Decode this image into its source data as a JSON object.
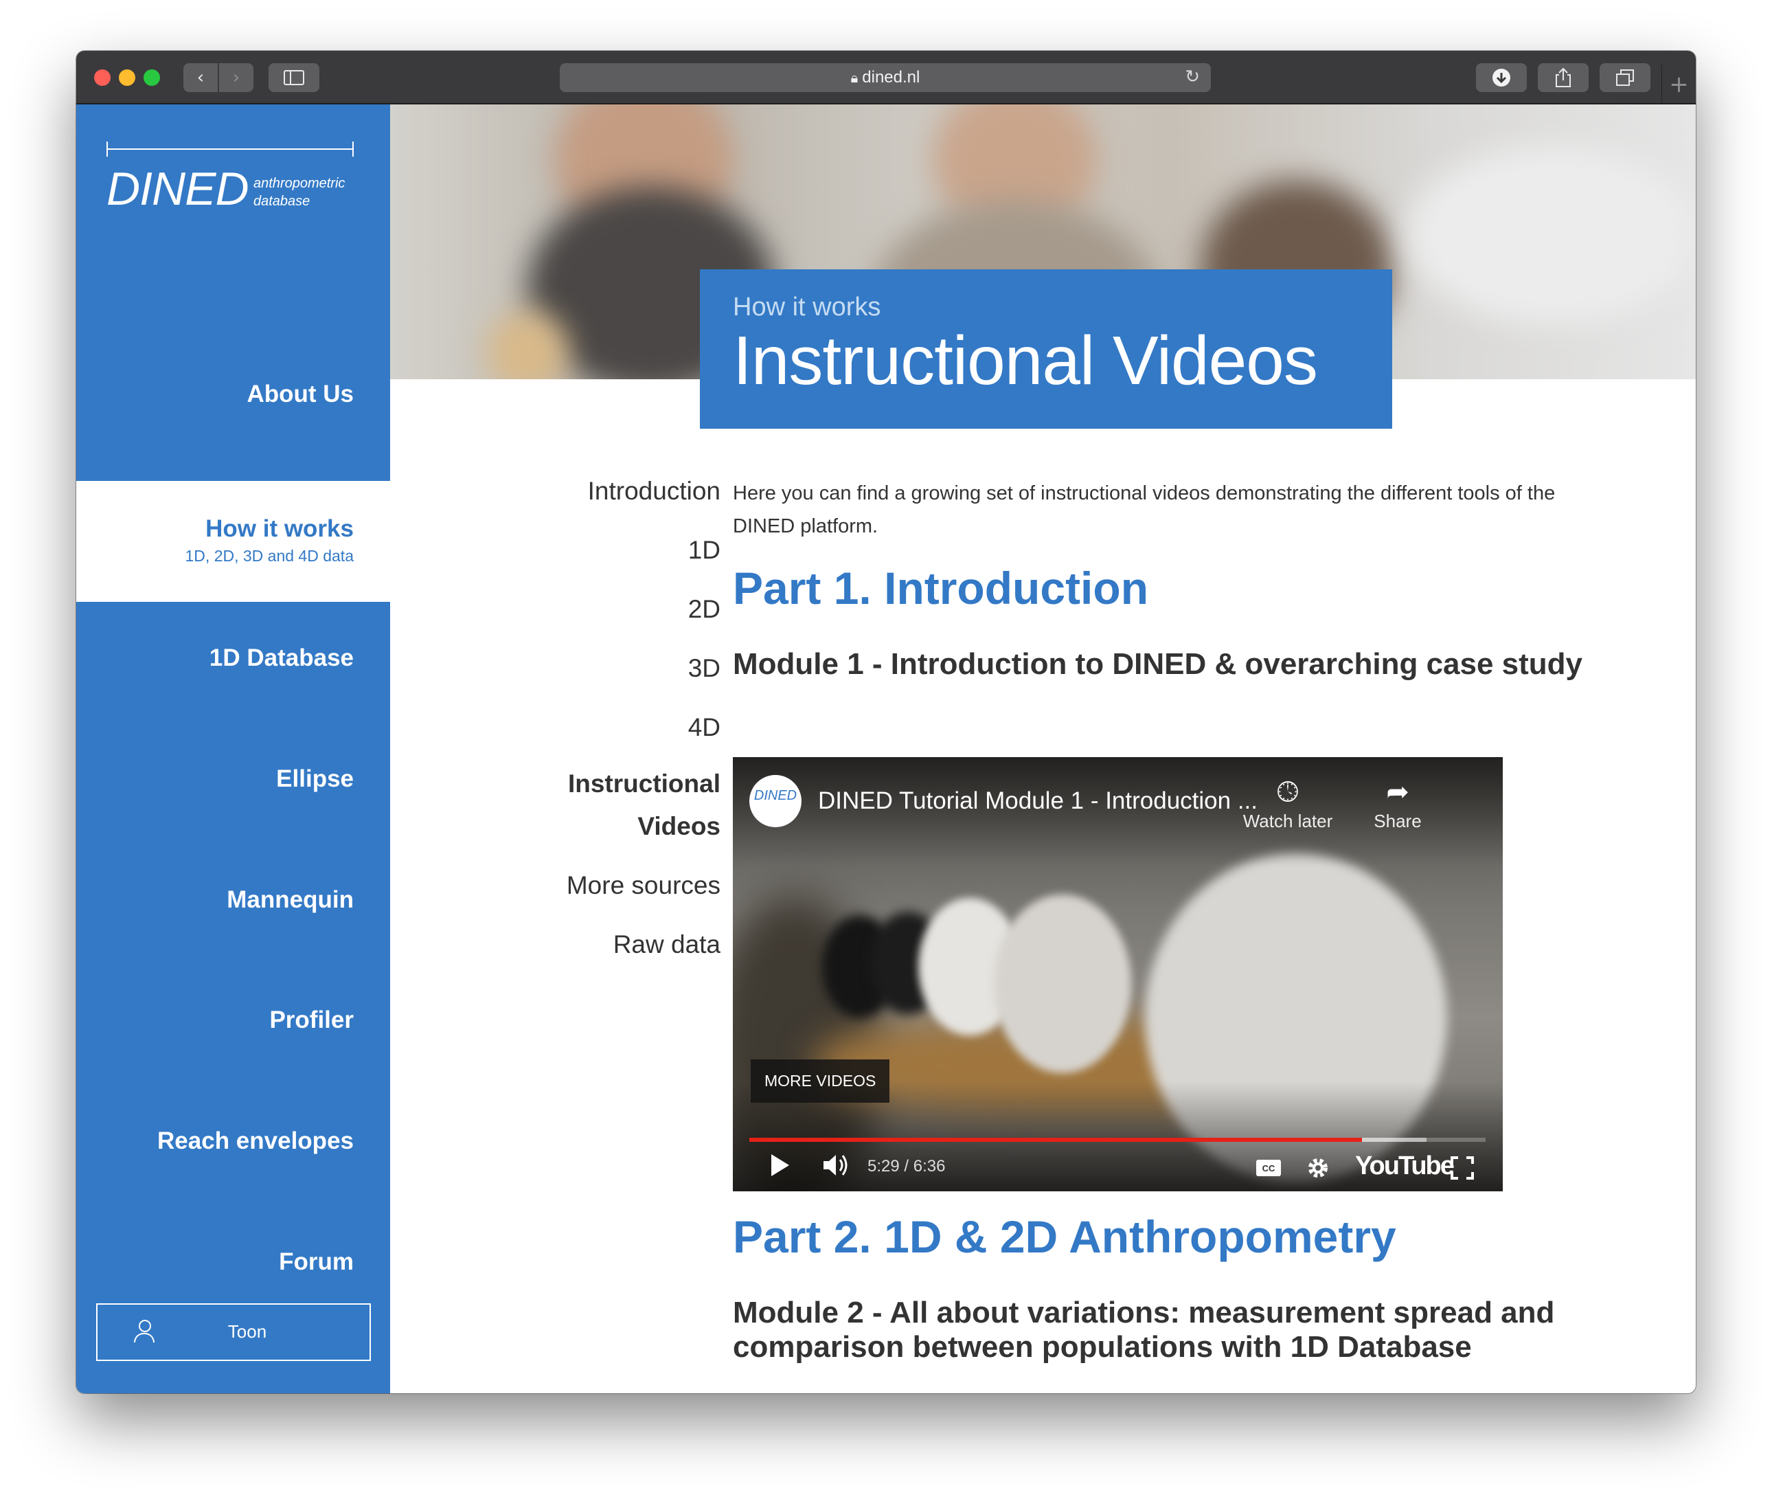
{
  "browser": {
    "url": "dined.nl"
  },
  "brand": {
    "name": "DINED",
    "tagline_line1": "anthropometric",
    "tagline_line2": "database",
    "color": "#3379c6"
  },
  "sidebar": {
    "items": [
      {
        "label": "About Us"
      },
      {
        "label": "How it works",
        "sublabel": "1D, 2D, 3D and 4D data",
        "active": true
      },
      {
        "label": "1D Database"
      },
      {
        "label": "Ellipse"
      },
      {
        "label": "Mannequin"
      },
      {
        "label": "Profiler"
      },
      {
        "label": "Reach envelopes"
      },
      {
        "label": "Forum"
      }
    ],
    "user": {
      "name": "Toon",
      "icon": "user-icon"
    }
  },
  "header": {
    "kicker": "How it works",
    "title": "Instructional Videos"
  },
  "subnav": {
    "items": [
      {
        "label": "Introduction"
      },
      {
        "label": "1D"
      },
      {
        "label": "2D"
      },
      {
        "label": "3D"
      },
      {
        "label": "4D"
      },
      {
        "label_line1": "Instructional",
        "label_line2": "Videos",
        "active": true
      },
      {
        "label": "More sources"
      },
      {
        "label": "Raw data"
      }
    ]
  },
  "content": {
    "intro": "Here you can find a growing set of instructional videos demonstrating the different tools of the DINED platform.",
    "part1": {
      "heading": "Part 1. Introduction",
      "module": "Module 1 - Introduction to DINED & overarching case study"
    },
    "part2": {
      "heading": "Part 2. 1D & 2D Anthropometry",
      "module": "Module 2 - All about variations: measurement spread and comparison between populations with 1D Database"
    }
  },
  "video": {
    "channel_avatar": "DINED",
    "title": "DINED Tutorial Module 1 - Introduction ...",
    "watch_later": "Watch later",
    "share": "Share",
    "more_videos": "MORE VIDEOS",
    "time": "5:29 / 6:36",
    "progress_played": 0.832,
    "progress_buffered": 0.92,
    "brand": "YouTube"
  }
}
